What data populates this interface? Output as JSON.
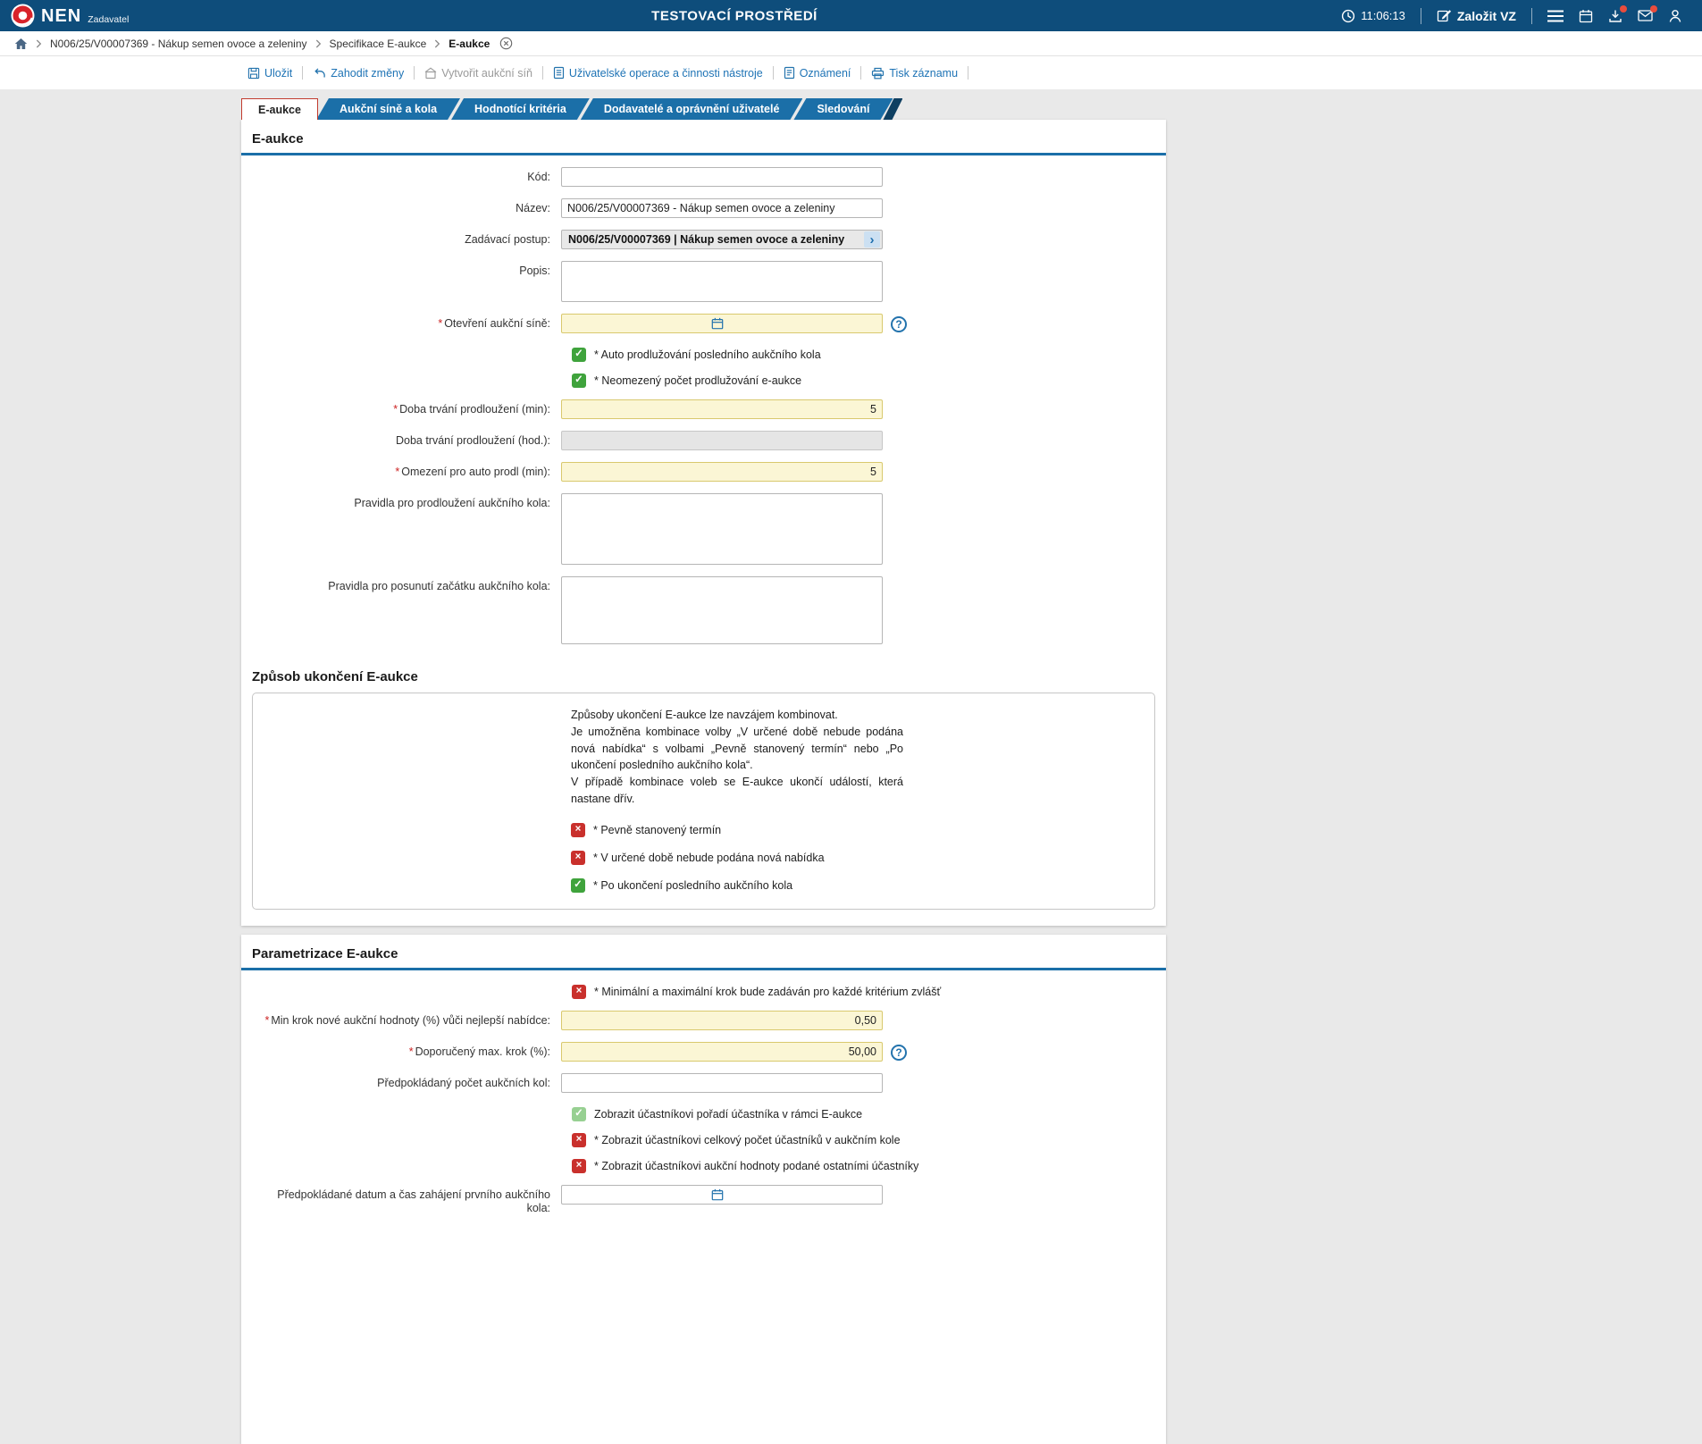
{
  "icons": {
    "check": "✓",
    "cross": "×",
    "chevron": "›",
    "question": "?"
  },
  "required_marker": "*",
  "topbar": {
    "logo": "NEN",
    "logo_sub": "Zadavatel",
    "title": "TESTOVACÍ PROSTŘEDÍ",
    "time": "11:06:13",
    "create_vz": "Založit VZ"
  },
  "breadcrumb": {
    "items": [
      "N006/25/V00007369 - Nákup semen ovoce a zeleniny",
      "Specifikace E-aukce",
      "E-aukce"
    ]
  },
  "toolbar": {
    "save": "Uložit",
    "discard": "Zahodit změny",
    "create_room": "Vytvořit aukční síň",
    "user_ops": "Uživatelské operace a činnosti nástroje",
    "notice": "Oznámení",
    "print": "Tisk záznamu"
  },
  "tabs": [
    "E-aukce",
    "Aukční síně a kola",
    "Hodnotící kritéria",
    "Dodavatelé a oprávnění uživatelé",
    "Sledování"
  ],
  "section1": {
    "title": "E-aukce",
    "kod_label": "Kód:",
    "kod_value": "",
    "nazev_label": "Název:",
    "nazev_value": "N006/25/V00007369 - Nákup semen ovoce a zeleniny",
    "postup_label": "Zadávací postup:",
    "postup_value": "N006/25/V00007369 | Nákup semen ovoce a zeleniny",
    "popis_label": "Popis:",
    "popis_value": "",
    "otevreni_label": "Otevření aukční síně:",
    "otevreni_value": "",
    "cb_auto": "* Auto prodlužování posledního aukčního kola",
    "cb_neomezeny": "* Neomezený počet prodlužování e-aukce",
    "doba_min_label": "Doba trvání prodloužení (min):",
    "doba_min_value": "5",
    "doba_hod_label": "Doba trvání prodloužení (hod.):",
    "doba_hod_value": "",
    "omezeni_label": "Omezení pro auto prodl (min):",
    "omezeni_value": "5",
    "pravidla_prodlouzeni_label": "Pravidla pro prodloužení aukčního kola:",
    "pravidla_prodlouzeni_value": "",
    "pravidla_posunuti_label": "Pravidla pro posunutí začátku aukčního kola:",
    "pravidla_posunuti_value": ""
  },
  "section2": {
    "title": "Způsob ukončení E-aukce",
    "info1": "Způsoby ukončení E-aukce lze navzájem kombinovat.",
    "info2": "Je umožněna kombinace volby „V určené době nebude podána nová nabídka“ s volbami „Pevně stanovený termín“ nebo „Po ukončení posledního aukčního kola“.",
    "info3": "V případě kombinace voleb se E-aukce ukončí událostí, která nastane dřív.",
    "cb_termin": "* Pevně stanovený termín",
    "cb_nabidka": "* V určené době nebude podána nová nabídka",
    "cb_kolo": "* Po ukončení posledního aukčního kola"
  },
  "section3": {
    "title": "Parametrizace E-aukce",
    "cb_krok": "* Minimální a maximální krok bude zadáván pro každé kritérium zvlášť",
    "min_krok_label": "Min krok nové aukční hodnoty (%) vůči nejlepší nabídce:",
    "min_krok_value": "0,50",
    "max_krok_label": "Doporučený max. krok (%):",
    "max_krok_value": "50,00",
    "pocet_kol_label": "Předpokládaný počet aukčních kol:",
    "pocet_kol_value": "",
    "cb_poradi": "Zobrazit účastníkovi pořadí účastníka v rámci E-aukce",
    "cb_pocet": "* Zobrazit účastníkovi celkový počet účastníků v aukčním kole",
    "cb_hodnoty": "* Zobrazit účastníkovi aukční hodnoty podané ostatními účastníky",
    "datum_label": "Předpokládané datum a čas zahájení prvního aukčního kola:",
    "datum_value": ""
  }
}
